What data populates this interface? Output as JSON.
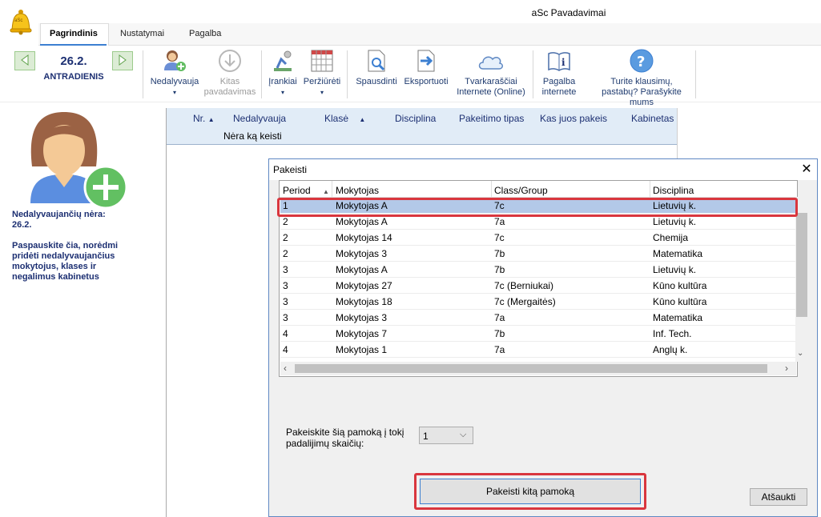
{
  "app": {
    "title": "aSc Pavadavimai",
    "logo_text": "aSc"
  },
  "tabs": [
    {
      "label": "Pagrindinis",
      "active": true
    },
    {
      "label": "Nustatymai",
      "active": false
    },
    {
      "label": "Pagalba",
      "active": false
    }
  ],
  "date": {
    "day": "26.2.",
    "weekday": "ANTRADIENIS"
  },
  "ribbon": {
    "absent": "Nedalyvauja",
    "other_line1": "Kitas",
    "other_line2": "pavadavimas",
    "tools": "Įrankiai",
    "view": "Peržiūrėti",
    "print": "Spausdinti",
    "export": "Eksportuoti",
    "online_line1": "Tvarkaraščiai",
    "online_line2": "Internete (Online)",
    "help_line1": "Pagalba",
    "help_line2": "internete",
    "feedback_line1": "Turite klausimų,",
    "feedback_line2": "pastabų? Parašykite mums"
  },
  "left_panel": {
    "no_absent": "Nedalyvaujančių nėra:",
    "date": "26.2.",
    "hint": "Paspauskite čia, norėdmi pridėti nedalyvaujančius mokytojus, klases ir negalimus kabinetus"
  },
  "grid": {
    "columns": [
      "Nr.",
      "Nedalyvauja",
      "Klasė",
      "Disciplina",
      "Pakeitimo tipas",
      "Kas juos pakeis",
      "Kabinetas"
    ],
    "empty_text": "Nėra ką keisti"
  },
  "dialog": {
    "title": "Pakeisti",
    "close": "✕",
    "columns": [
      "Period",
      "Mokytojas",
      "Class/Group",
      "Disciplina"
    ],
    "rows": [
      {
        "period": "1",
        "teacher": "Mokytojas A",
        "class": "7c",
        "subject": "Lietuvių k.",
        "selected": true
      },
      {
        "period": "2",
        "teacher": "Mokytojas A",
        "class": "7a",
        "subject": "Lietuvių k.",
        "selected": false
      },
      {
        "period": "2",
        "teacher": "Mokytojas 14",
        "class": "7c",
        "subject": "Chemija",
        "selected": false
      },
      {
        "period": "2",
        "teacher": "Mokytojas 3",
        "class": "7b",
        "subject": "Matematika",
        "selected": false
      },
      {
        "period": "3",
        "teacher": "Mokytojas A",
        "class": "7b",
        "subject": "Lietuvių k.",
        "selected": false
      },
      {
        "period": "3",
        "teacher": "Mokytojas 27",
        "class": "7c (Berniukai)",
        "subject": "Kūno kultūra",
        "selected": false
      },
      {
        "period": "3",
        "teacher": "Mokytojas 18",
        "class": "7c (Mergaitės)",
        "subject": "Kūno kultūra",
        "selected": false
      },
      {
        "period": "3",
        "teacher": "Mokytojas 3",
        "class": "7a",
        "subject": "Matematika",
        "selected": false
      },
      {
        "period": "4",
        "teacher": "Mokytojas 7",
        "class": "7b",
        "subject": "Inf. Tech.",
        "selected": false
      },
      {
        "period": "4",
        "teacher": "Mokytojas 1",
        "class": "7a",
        "subject": "Anglų k.",
        "selected": false
      }
    ],
    "split_label_line1": "Pakeiskite šią pamoką į tokį",
    "split_label_line2": "padalijimų skaičių:",
    "split_value": "1",
    "replace_button": "Pakeisti kitą pamoką",
    "cancel_button": "Atšaukti"
  },
  "colors": {
    "accent": "#3c7fd1",
    "selection": "#b3c9e8",
    "highlight": "#d9363e",
    "header": "#e1ecf7"
  }
}
